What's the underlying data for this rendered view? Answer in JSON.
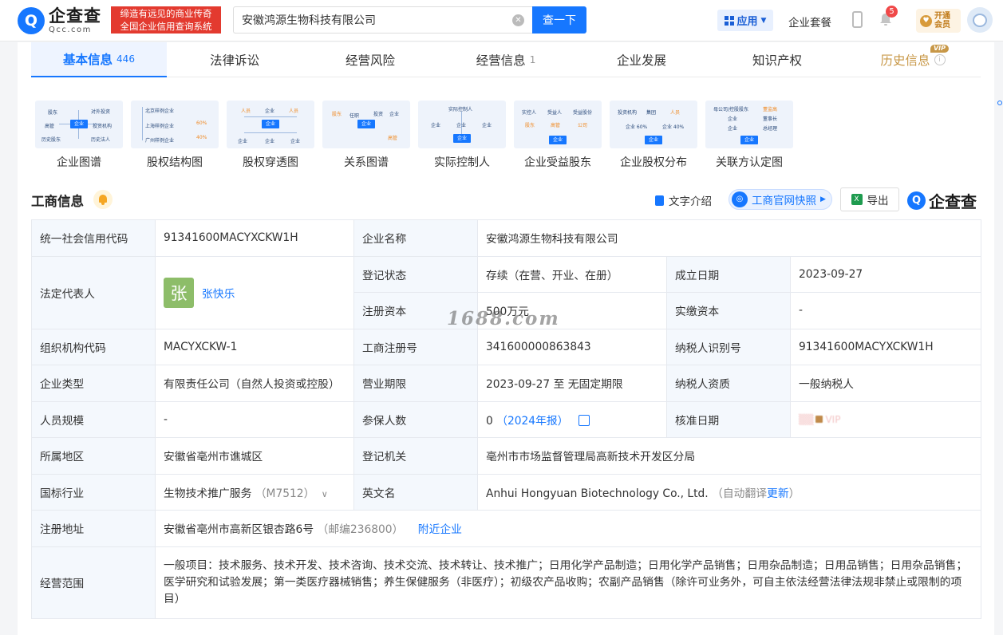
{
  "header": {
    "logo_mark": "Q",
    "logo_cn": "企查查",
    "logo_en": "Qcc.com",
    "slogan_line1": "缔造有远见的商业传奇",
    "slogan_line2": "全国企业信用查询系统",
    "search_value": "安徽鸿源生物科技有限公司",
    "search_button": "查一下",
    "apps_label": "应用",
    "package_label": "企业套餐",
    "notification_count": "5",
    "vip_line1": "开通",
    "vip_line2": "会员"
  },
  "tabs": [
    {
      "label": "基本信息",
      "count": "446"
    },
    {
      "label": "法律诉讼",
      "count": ""
    },
    {
      "label": "经营风险",
      "count": ""
    },
    {
      "label": "经营信息",
      "count": "1"
    },
    {
      "label": "企业发展",
      "count": ""
    },
    {
      "label": "知识产权",
      "count": ""
    },
    {
      "label": "历史信息",
      "count": "",
      "tag": "VIP"
    }
  ],
  "graphs": [
    {
      "label": "企业图谱"
    },
    {
      "label": "股权结构图"
    },
    {
      "label": "股权穿透图"
    },
    {
      "label": "关系图谱"
    },
    {
      "label": "实际控制人"
    },
    {
      "label": "企业受益股东"
    },
    {
      "label": "企业股权分布"
    },
    {
      "label": "关联方认定图"
    }
  ],
  "graph_thumbs": {
    "g1": {
      "a": "股东",
      "b": "对外投资",
      "c": "高管",
      "d": "投资机构",
      "e": "历史股东",
      "f": "历史法人",
      "core": "企业"
    },
    "g2": {
      "a": "北京样例企业",
      "b": "上海样例企业",
      "c": "广州样例企业",
      "p1": "60%",
      "p2": "40%",
      "core": "企业"
    },
    "g3": {
      "a": "人员",
      "b": "企业",
      "c": "人员",
      "d": "企业",
      "e": "企业",
      "f": "企业",
      "core": "企业"
    },
    "g4": {
      "a": "股东",
      "b": "任职",
      "c": "投资",
      "d": "企业",
      "e": "高管",
      "core": "企业"
    },
    "g5": {
      "a": "实际控制人",
      "b": "企业",
      "c": "企业",
      "d": "企业",
      "core": "企业"
    },
    "g6": {
      "a": "实控人",
      "b": "受益人",
      "c": "受益股份",
      "d": "股东",
      "e": "高管",
      "f": "公司",
      "core": "企业"
    },
    "g7": {
      "a": "投资机构",
      "b": "集团",
      "c": "人员",
      "d": "企业 60%",
      "e": "企业 40%",
      "core": "企业"
    },
    "g8": {
      "a": "母公司/控股股东",
      "b": "董监高",
      "c": "企业",
      "d": "董事长",
      "e": "企业",
      "f": "总经理",
      "core": "企业"
    }
  },
  "section": {
    "title": "工商信息",
    "text_intro": "文字介绍",
    "snapshot": "工商官网快照",
    "export": "导出",
    "brand": "企查查"
  },
  "info": {
    "credit_code_label": "统一社会信用代码",
    "credit_code": "91341600MACYXCKW1H",
    "company_name_label": "企业名称",
    "company_name": "安徽鸿源生物科技有限公司",
    "legal_rep_label": "法定代表人",
    "legal_rep_avatar": "张",
    "legal_rep": "张快乐",
    "reg_status_label": "登记状态",
    "reg_status": "存续（在营、开业、在册）",
    "founded_label": "成立日期",
    "founded": "2023-09-27",
    "reg_capital_label": "注册资本",
    "reg_capital": "500万元",
    "paid_capital_label": "实缴资本",
    "paid_capital": "-",
    "org_code_label": "组织机构代码",
    "org_code": "MACYXCKW-1",
    "biz_reg_no_label": "工商注册号",
    "biz_reg_no": "341600000863843",
    "taxpayer_id_label": "纳税人识别号",
    "taxpayer_id": "91341600MACYXCKW1H",
    "company_type_label": "企业类型",
    "company_type": "有限责任公司（自然人投资或控股）",
    "term_label": "营业期限",
    "term": "2023-09-27 至 无固定期限",
    "taxpayer_qual_label": "纳税人资质",
    "taxpayer_qual": "一般纳税人",
    "staff_size_label": "人员规模",
    "staff_size": "-",
    "insured_label": "参保人数",
    "insured": "0",
    "insured_year": "（2024年报）",
    "approval_date_label": "核准日期",
    "approval_date_masked": "VIP",
    "region_label": "所属地区",
    "region": "安徽省亳州市谯城区",
    "authority_label": "登记机关",
    "authority": "亳州市市场监督管理局高新技术开发区分局",
    "industry_label": "国标行业",
    "industry": "生物技术推广服务",
    "industry_code": "（M7512）",
    "english_name_label": "英文名",
    "english_name": "Anhui Hongyuan Biotechnology Co., Ltd.",
    "english_note": "（自动翻译",
    "english_update": "更新",
    "english_close": "）",
    "address_label": "注册地址",
    "address": "安徽省亳州市高新区银杏路6号",
    "postcode": "（邮编236800）",
    "nearby": "附近企业",
    "scope_label": "经营范围",
    "scope": "一般项目：技术服务、技术开发、技术咨询、技术交流、技术转让、技术推广；日用化学产品制造；日用化学产品销售；日用杂品制造；日用品销售；日用杂品销售；医学研究和试验发展；第一类医疗器械销售；养生保健服务（非医疗）；初级农产品收购；农副产品销售（除许可业务外，可自主依法经营法律法规非禁止或限制的项目）"
  },
  "watermark": "1688.com",
  "colors": {
    "accent": "#1677ff",
    "slogan_bg": "#e33a2f",
    "label_bg": "#f4f8fd",
    "vip_gold": "#c89848"
  }
}
